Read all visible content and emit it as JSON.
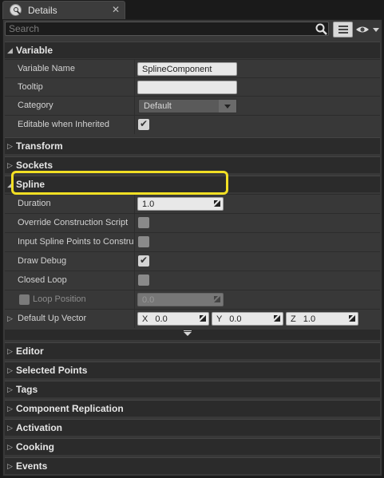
{
  "tab": {
    "title": "Details",
    "close_glyph": "✕",
    "icon": "details-info-icon"
  },
  "search": {
    "placeholder": "Search",
    "icon": "search-icon"
  },
  "toolbar": {
    "view_options_icon": "list-view-icon",
    "visibility_icon": "eye-icon"
  },
  "sections": {
    "variable": {
      "label": "Variable",
      "expanded": true
    },
    "transform": {
      "label": "Transform",
      "expanded": false
    },
    "sockets": {
      "label": "Sockets",
      "expanded": false
    },
    "spline": {
      "label": "Spline",
      "expanded": true
    },
    "editor": {
      "label": "Editor",
      "expanded": false
    },
    "selected_points": {
      "label": "Selected Points",
      "expanded": false
    },
    "tags": {
      "label": "Tags",
      "expanded": false
    },
    "component_replication": {
      "label": "Component Replication",
      "expanded": false
    },
    "activation": {
      "label": "Activation",
      "expanded": false
    },
    "cooking": {
      "label": "Cooking",
      "expanded": false
    },
    "events": {
      "label": "Events",
      "expanded": false
    }
  },
  "variable": {
    "name_label": "Variable Name",
    "name_value": "SplineComponent",
    "tooltip_label": "Tooltip",
    "tooltip_value": "",
    "category_label": "Category",
    "category_value": "Default",
    "editable_label": "Editable when Inherited",
    "editable_checked": true
  },
  "spline": {
    "duration_label": "Duration",
    "duration_value": "1.0",
    "override_label": "Override Construction Script",
    "override_checked": false,
    "input_points_label": "Input Spline Points to Construction Script",
    "input_points_checked": false,
    "draw_debug_label": "Draw Debug",
    "draw_debug_checked": true,
    "closed_loop_label": "Closed Loop",
    "closed_loop_checked": false,
    "loop_position_label": "Loop Position",
    "loop_position_value": "0.0",
    "up_vector_label": "Default Up Vector",
    "up_vector": {
      "x_label": "X",
      "x": "0.0",
      "y_label": "Y",
      "y": "0.0",
      "z_label": "Z",
      "z": "1.0"
    }
  },
  "colors": {
    "highlight": "#f1df24",
    "panel_bg": "#383838",
    "section_bg": "#2b2b2b"
  }
}
